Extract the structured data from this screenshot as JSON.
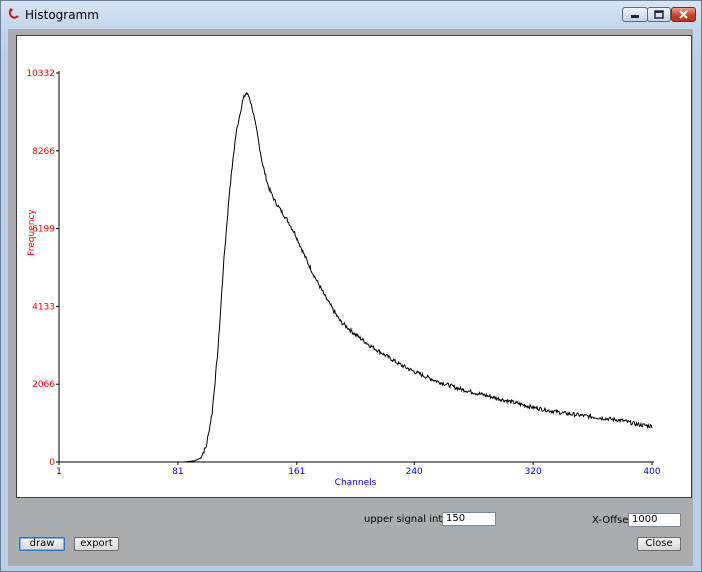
{
  "window": {
    "title": "Histogramm"
  },
  "controls": {
    "upper_signal_intensity_label": "upper signal intensity",
    "upper_signal_intensity_value": "150",
    "x_offset_label": "X-Offset",
    "x_offset_value": "1000",
    "draw_label": "draw",
    "export_label": "export",
    "close_label": "Close"
  },
  "colors": {
    "y_axis_text": "#ff0000",
    "x_axis_text": "#0000ff",
    "curve": "#000000"
  },
  "chart_data": {
    "type": "line",
    "title": "",
    "xlabel": "Channels",
    "ylabel": "Frequency",
    "xlim": [
      1,
      400
    ],
    "ylim": [
      0,
      10332
    ],
    "x_ticks": [
      "1",
      "81",
      "161",
      "240",
      "320",
      "400"
    ],
    "y_ticks": [
      "0",
      "2066",
      "4133",
      "6199",
      "8266",
      "10332"
    ],
    "grid": false,
    "series": [
      {
        "x": [
          1,
          60,
          85,
          92,
          96,
          100,
          104,
          108,
          112,
          116,
          120,
          123,
          125,
          127,
          129,
          131,
          134,
          138,
          142,
          146,
          150,
          155,
          160,
          166,
          172,
          180,
          190,
          200,
          210,
          220,
          230,
          240,
          255,
          270,
          285,
          300,
          320,
          340,
          360,
          380,
          390,
          400
        ],
        "y": [
          0,
          0,
          0,
          30,
          100,
          400,
          1300,
          3000,
          5400,
          7300,
          8700,
          9300,
          9650,
          9800,
          9700,
          9400,
          8800,
          7900,
          7300,
          6950,
          6700,
          6400,
          6050,
          5500,
          5000,
          4400,
          3750,
          3400,
          3100,
          2850,
          2600,
          2400,
          2150,
          1950,
          1800,
          1650,
          1450,
          1300,
          1200,
          1100,
          1000,
          950
        ]
      }
    ]
  }
}
